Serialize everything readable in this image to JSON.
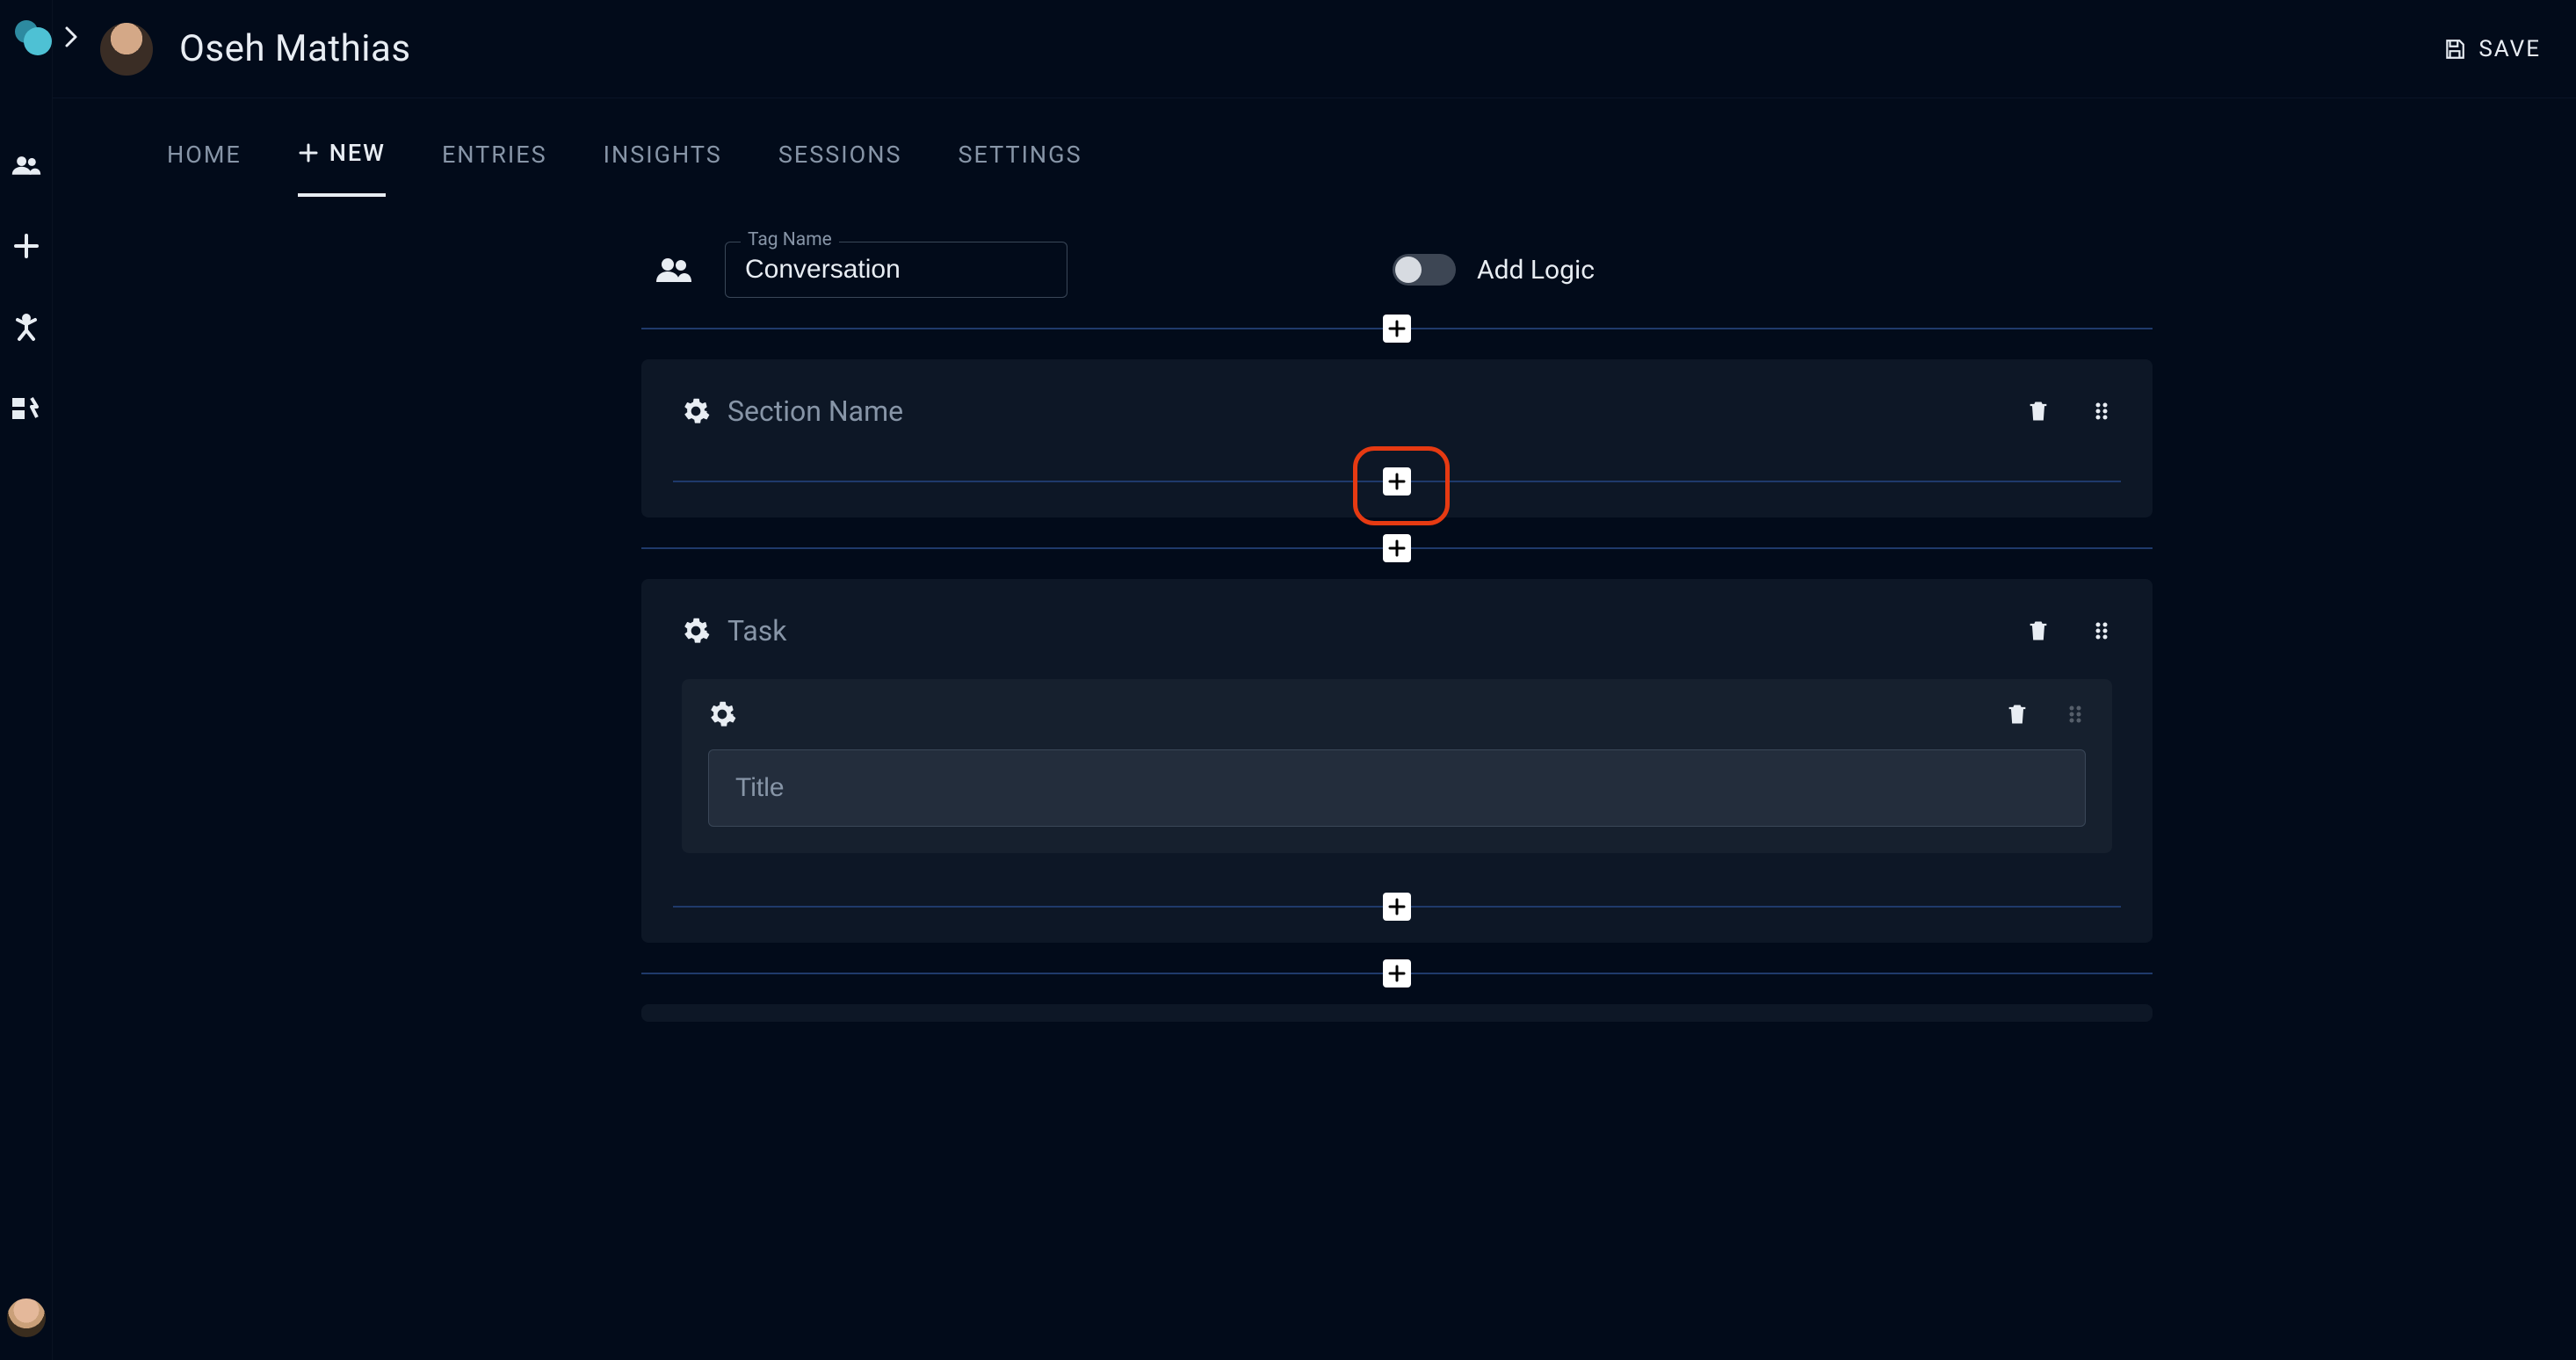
{
  "header": {
    "user_name": "Oseh Mathias",
    "save_label": "SAVE"
  },
  "tabs": [
    {
      "label": "HOME",
      "active": false
    },
    {
      "label": "NEW",
      "active": true,
      "icon": "plus"
    },
    {
      "label": "ENTRIES",
      "active": false
    },
    {
      "label": "INSIGHTS",
      "active": false
    },
    {
      "label": "SESSIONS",
      "active": false
    },
    {
      "label": "SETTINGS",
      "active": false
    }
  ],
  "tag_field": {
    "label": "Tag Name",
    "value": "Conversation"
  },
  "logic_toggle": {
    "label": "Add Logic",
    "on": false
  },
  "sections": [
    {
      "name_placeholder": "Section Name",
      "name_value": "",
      "highlighted_add": true,
      "items": []
    },
    {
      "name_placeholder": "",
      "name_value": "Task",
      "highlighted_add": false,
      "items": [
        {
          "title_placeholder": "Title",
          "title_value": ""
        }
      ]
    }
  ],
  "sidebar": {
    "items": [
      "people",
      "plus",
      "activity",
      "bolt"
    ]
  }
}
